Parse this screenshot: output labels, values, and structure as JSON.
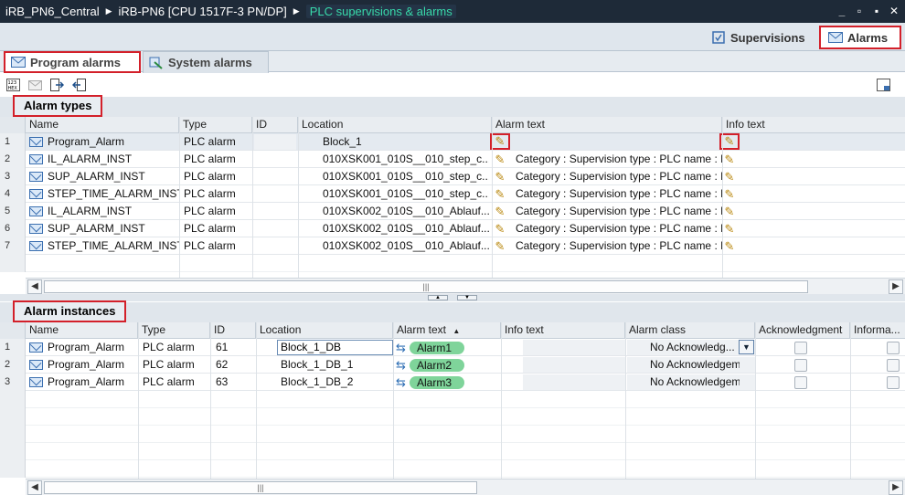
{
  "titlebar": {
    "crumbs": [
      "iRB_PN6_Central",
      "iRB-PN6 [CPU 1517F-3 PN/DP]",
      "PLC supervisions & alarms"
    ],
    "buttons": [
      "_",
      "▫",
      "▪",
      "✕"
    ]
  },
  "editor_tabs": {
    "supervisions": "Supervisions",
    "alarms": "Alarms"
  },
  "sub_tabs": {
    "program_alarms": "Program alarms",
    "system_alarms": "System alarms"
  },
  "alarm_types": {
    "title": "Alarm types",
    "columns": [
      "Name",
      "Type",
      "ID",
      "Location",
      "Alarm text",
      "Info text"
    ],
    "rows": [
      {
        "num": "1",
        "name": "Program_Alarm",
        "type": "PLC alarm",
        "id": "",
        "location": "Block_1",
        "alarm_text": "",
        "info_text": ""
      },
      {
        "num": "2",
        "name": "IL_ALARM_INST",
        "type": "PLC alarm",
        "id": "",
        "location": "010XSK001_010S__010_step_c...",
        "alarm_text": "Category : Supervision type : PLC name : F",
        "info_text": ""
      },
      {
        "num": "3",
        "name": "SUP_ALARM_INST",
        "type": "PLC alarm",
        "id": "",
        "location": "010XSK001_010S__010_step_c...",
        "alarm_text": "Category : Supervision type : PLC name : F",
        "info_text": ""
      },
      {
        "num": "4",
        "name": "STEP_TIME_ALARM_INST",
        "type": "PLC alarm",
        "id": "",
        "location": "010XSK001_010S__010_step_c...",
        "alarm_text": "Category : Supervision type : PLC name : F",
        "info_text": ""
      },
      {
        "num": "5",
        "name": "IL_ALARM_INST",
        "type": "PLC alarm",
        "id": "",
        "location": "010XSK002_010S__010_Ablauf...",
        "alarm_text": "Category : Supervision type : PLC name : F",
        "info_text": ""
      },
      {
        "num": "6",
        "name": "SUP_ALARM_INST",
        "type": "PLC alarm",
        "id": "",
        "location": "010XSK002_010S__010_Ablauf...",
        "alarm_text": "Category : Supervision type : PLC name : F",
        "info_text": ""
      },
      {
        "num": "7",
        "name": "STEP_TIME_ALARM_INST",
        "type": "PLC alarm",
        "id": "",
        "location": "010XSK002_010S__010_Ablauf...",
        "alarm_text": "Category : Supervision type : PLC name : F",
        "info_text": ""
      }
    ]
  },
  "alarm_instances": {
    "title": "Alarm instances",
    "columns": [
      "Name",
      "Type",
      "ID",
      "Location",
      "Alarm text",
      "Info text",
      "Alarm class",
      "Acknowledgment",
      "Informa..."
    ],
    "rows": [
      {
        "num": "1",
        "name": "Program_Alarm",
        "type": "PLC alarm",
        "id": "61",
        "location": "Block_1_DB",
        "alarm_text": "Alarm1",
        "alarm_class": "No Acknowledg..."
      },
      {
        "num": "2",
        "name": "Program_Alarm",
        "type": "PLC alarm",
        "id": "62",
        "location": "Block_1_DB_1",
        "alarm_text": "Alarm2",
        "alarm_class": "No Acknowledgem..."
      },
      {
        "num": "3",
        "name": "Program_Alarm",
        "type": "PLC alarm",
        "id": "63",
        "location": "Block_1_DB_2",
        "alarm_text": "Alarm3",
        "alarm_class": "No Acknowledgem..."
      }
    ]
  },
  "colors": {
    "highlight": "#d3202a",
    "titlebar": "#1e2a38",
    "active_crumb": "#38d9a9",
    "alarm_pill": "#7fd49a"
  }
}
